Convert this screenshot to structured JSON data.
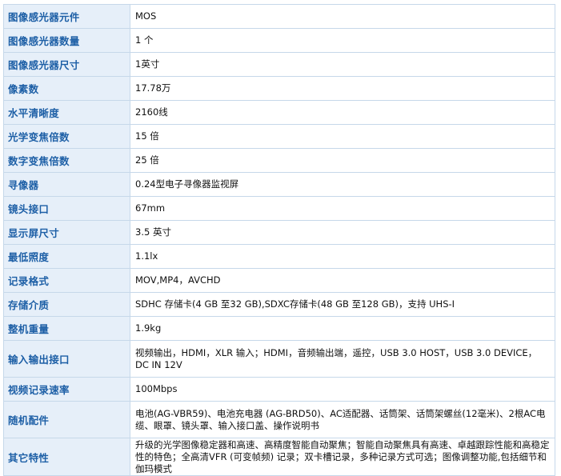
{
  "specs": [
    {
      "label": "图像感光器元件",
      "value": "MOS"
    },
    {
      "label": "图像感光器数量",
      "value": "1 个"
    },
    {
      "label": "图像感光器尺寸",
      "value": "1英寸"
    },
    {
      "label": "像素数",
      "value": "17.78万"
    },
    {
      "label": "水平清晰度",
      "value": "2160线"
    },
    {
      "label": "光学变焦倍数",
      "value": "15 倍"
    },
    {
      "label": "数字变焦倍数",
      "value": "25 倍"
    },
    {
      "label": "寻像器",
      "value": "0.24型电子寻像器监视屏"
    },
    {
      "label": "镜头接口",
      "value": "67mm"
    },
    {
      "label": "显示屏尺寸",
      "value": "3.5 英寸"
    },
    {
      "label": "最低照度",
      "value": "1.1lx"
    },
    {
      "label": "记录格式",
      "value": "MOV,MP4，AVCHD"
    },
    {
      "label": "存储介质",
      "value": "SDHC 存储卡(4 GB 至32 GB),SDXC存储卡(48 GB 至128 GB)，支持  UHS-I"
    },
    {
      "label": "整机重量",
      "value": "1.9kg"
    },
    {
      "label": "输入输出接口",
      "value": "视频输出，HDMI，XLR 输入；HDMI，音频输出端，遥控，USB 3.0 HOST，USB 3.0 DEVICE，DC IN 12V"
    },
    {
      "label": "视频记录速率",
      "value": "100Mbps"
    },
    {
      "label": "随机配件",
      "value": "电池(AG-VBR59)、电池充电器 (AG-BRD50)、AC适配器、话筒架、话筒架螺丝(12毫米)、2根AC电缆、眼罩、镜头罩、输入接口盖、操作说明书"
    },
    {
      "label": "其它特性",
      "value": "升级的光学图像稳定器和高速、高精度智能自动聚焦；智能自动聚焦具有高速、卓越跟踪性能和高稳定性的特色；全高清VFR (可变帧频) 记录；双卡槽记录，多种记录方式可选；图像调整功能,包括细节和伽玛模式"
    }
  ]
}
